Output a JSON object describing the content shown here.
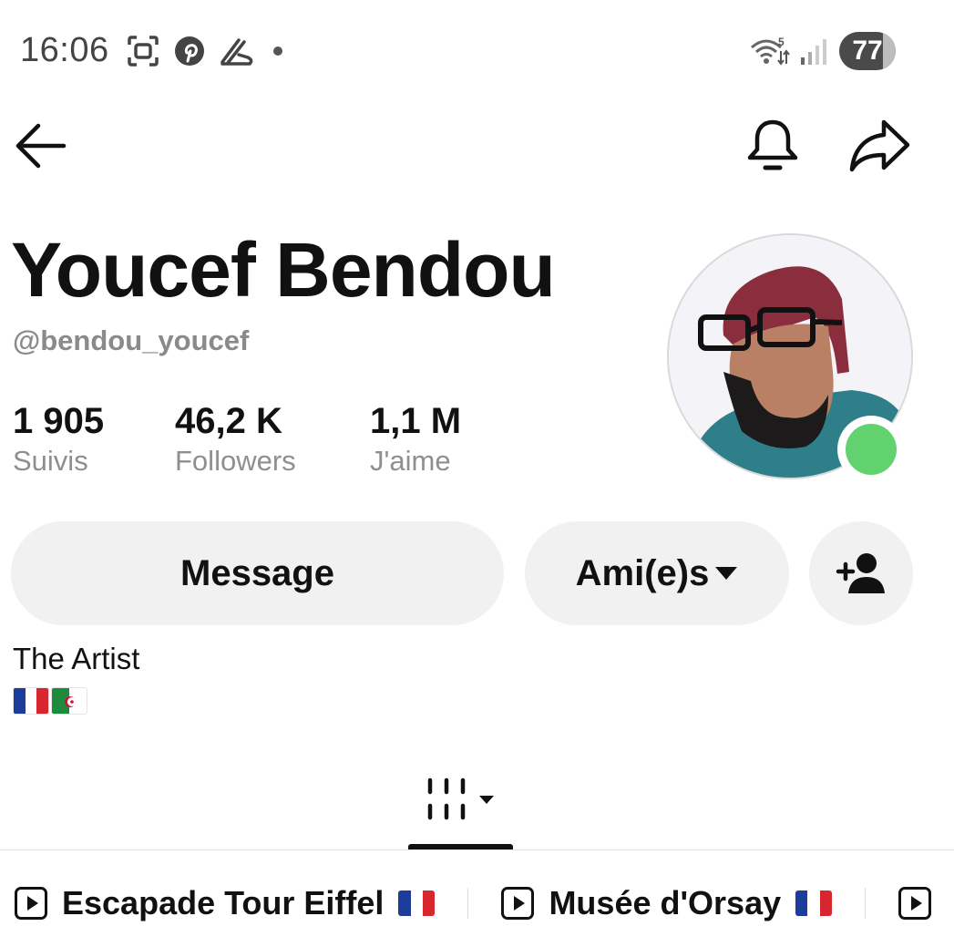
{
  "status_bar": {
    "time": "16:06",
    "battery": "77",
    "icons": [
      "screen-record-icon",
      "pinterest-icon",
      "running-shoe-icon",
      "dot-icon",
      "wifi-icon",
      "signal-icon",
      "battery-icon"
    ]
  },
  "nav": {
    "icons": [
      "back-arrow-icon",
      "bell-icon",
      "share-icon"
    ]
  },
  "profile": {
    "name": "Youcef Bendou",
    "handle": "@bendou_youcef",
    "stats": [
      {
        "value": "1 905",
        "label": "Suivis"
      },
      {
        "value": "46,2 K",
        "label": "Followers"
      },
      {
        "value": "1,1 M",
        "label": "J'aime"
      }
    ],
    "online_color": "#62d26f"
  },
  "actions": {
    "message_label": "Message",
    "friends_label": "Ami(e)s"
  },
  "bio": {
    "text": "The Artist",
    "flags": [
      "france-flag",
      "algeria-flag"
    ]
  },
  "playlists": [
    {
      "title": "Escapade Tour Eiffel",
      "flag": "france-flag"
    },
    {
      "title": "Musée d'Orsay",
      "flag": "france-flag"
    }
  ]
}
